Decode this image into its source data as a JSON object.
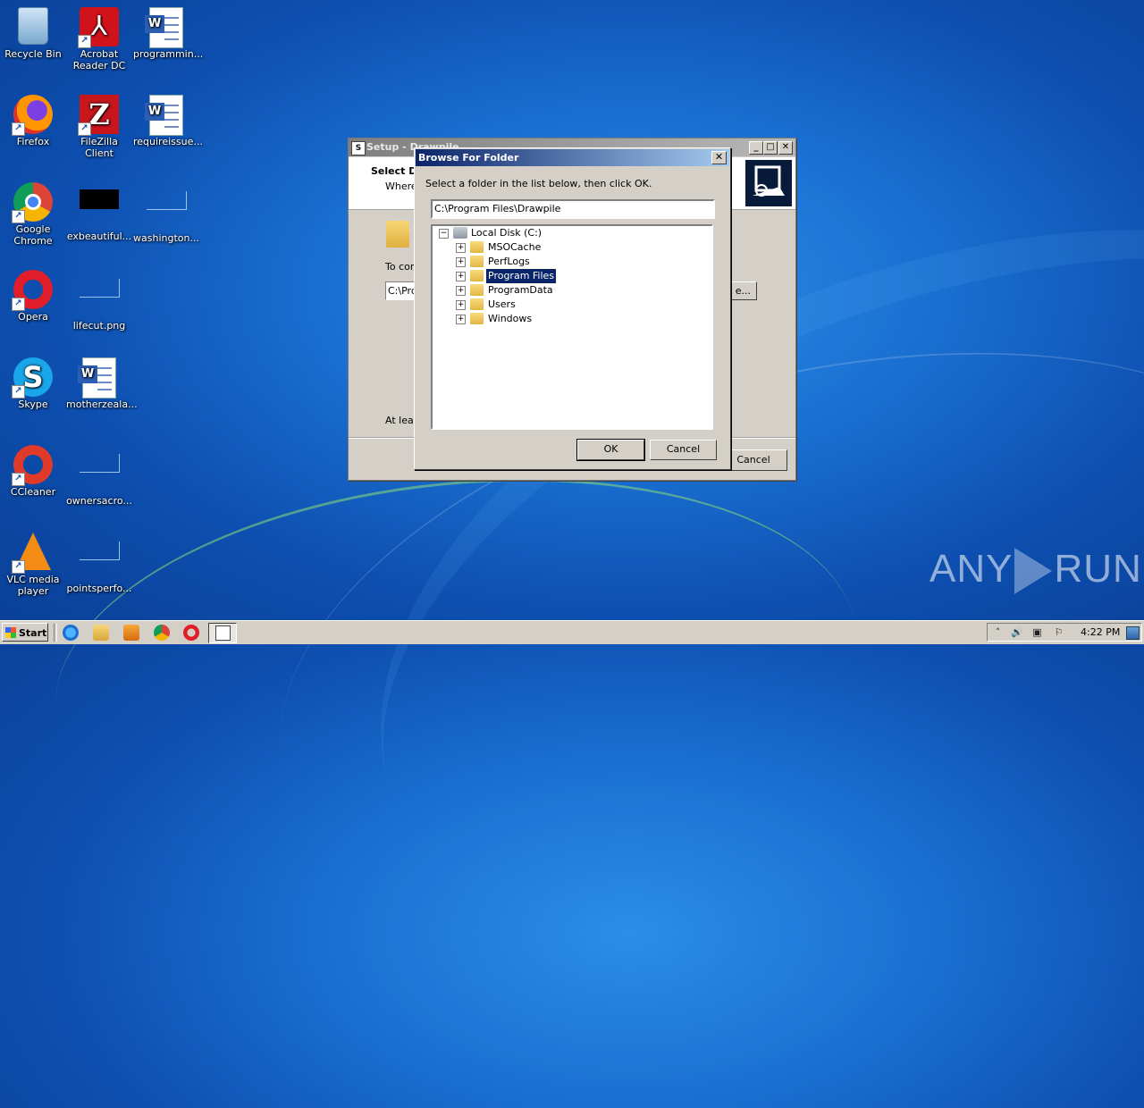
{
  "desktop": {
    "icons": [
      {
        "label": "Recycle Bin",
        "icon": "recycle-bin-icon"
      },
      {
        "label": "Acrobat Reader DC",
        "icon": "acrobat-icon"
      },
      {
        "label": "programmin...",
        "icon": "word-document-icon"
      },
      {
        "label": "Firefox",
        "icon": "firefox-icon"
      },
      {
        "label": "FileZilla Client",
        "icon": "filezilla-icon"
      },
      {
        "label": "requireissue...",
        "icon": "word-document-icon"
      },
      {
        "label": "Google Chrome",
        "icon": "chrome-icon"
      },
      {
        "label": "exbeautiful...",
        "icon": "image-thumbnail-icon"
      },
      {
        "label": "washington...",
        "icon": "image-thumbnail-icon"
      },
      {
        "label": "Opera",
        "icon": "opera-icon"
      },
      {
        "label": "lifecut.png",
        "icon": "image-thumbnail-icon"
      },
      {
        "label": "Skype",
        "icon": "skype-icon"
      },
      {
        "label": "motherzeala...",
        "icon": "word-document-icon"
      },
      {
        "label": "CCleaner",
        "icon": "ccleaner-icon"
      },
      {
        "label": "ownersacro...",
        "icon": "image-thumbnail-icon"
      },
      {
        "label": "VLC media player",
        "icon": "vlc-icon"
      },
      {
        "label": "pointsperfo...",
        "icon": "image-thumbnail-icon"
      }
    ],
    "glyphs": {
      "acrobat": "⅄",
      "word_w": "W",
      "filezilla": "Z",
      "skype": "S",
      "shortcut_arrow": "↗"
    }
  },
  "setup_window": {
    "title": "Setup - Drawpile",
    "app_icon_glyph": "S",
    "header_title": "Select De",
    "header_subtitle": "Where",
    "to_continue": "To con",
    "dot": ".",
    "path_value": "C:\\Pro",
    "browse_label": "e...",
    "at_least": "At leas",
    "cancel_label": "Cancel",
    "min_glyph": "_",
    "max_glyph": "□",
    "close_glyph": "✕"
  },
  "browse_dialog": {
    "title": "Browse For Folder",
    "close_glyph": "✕",
    "instruction": "Select a folder in the list below, then click OK.",
    "folder_value": "C:\\Program Files\\Drawpile",
    "tree": {
      "root_label": "Local Disk (C:)",
      "root_expander": "−",
      "items": [
        {
          "label": "MSOCache",
          "expander": "+"
        },
        {
          "label": "PerfLogs",
          "expander": "+"
        },
        {
          "label": "Program Files",
          "expander": "+",
          "selected": true
        },
        {
          "label": "ProgramData",
          "expander": "+"
        },
        {
          "label": "Users",
          "expander": "+"
        },
        {
          "label": "Windows",
          "expander": "+"
        }
      ]
    },
    "ok_label": "OK",
    "cancel_label": "Cancel"
  },
  "watermark": {
    "left": "ANY",
    "right": "RUN"
  },
  "taskbar": {
    "start_label": "Start",
    "quick_launch": [
      "internet-explorer-icon",
      "explorer-folder-icon",
      "media-player-icon",
      "chrome-icon",
      "opera-icon"
    ],
    "active_task_icon": "setup-app-icon",
    "tray": {
      "icons": [
        "tray-expand-icon",
        "volume-icon",
        "network-icon",
        "action-center-flag-icon"
      ],
      "glyphs": {
        "expand": "˄",
        "volume": "🔊",
        "network": "▣",
        "flag": "⚐"
      },
      "time": "4:22 PM"
    }
  }
}
